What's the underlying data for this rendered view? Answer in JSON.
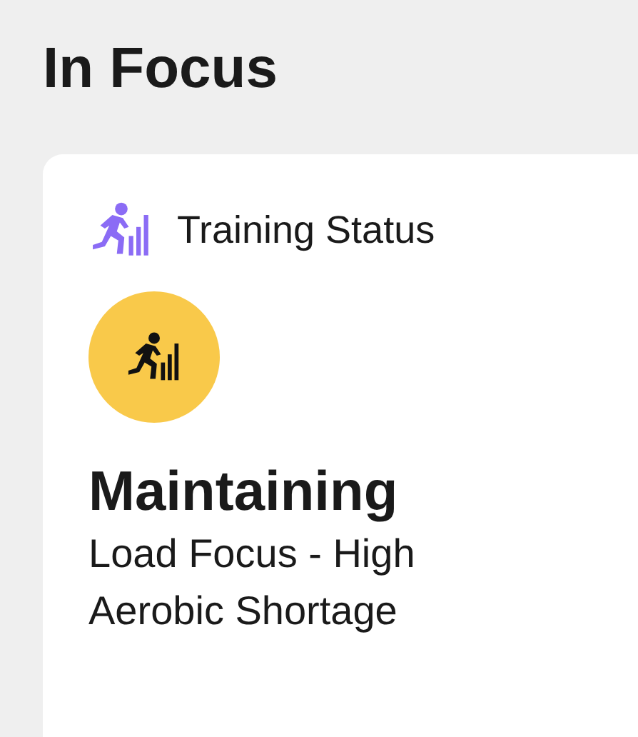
{
  "page": {
    "title": "In Focus"
  },
  "card": {
    "title": "Training Status",
    "status": "Maintaining",
    "lines": [
      "Load Focus - High",
      "Aerobic Shortage"
    ]
  }
}
